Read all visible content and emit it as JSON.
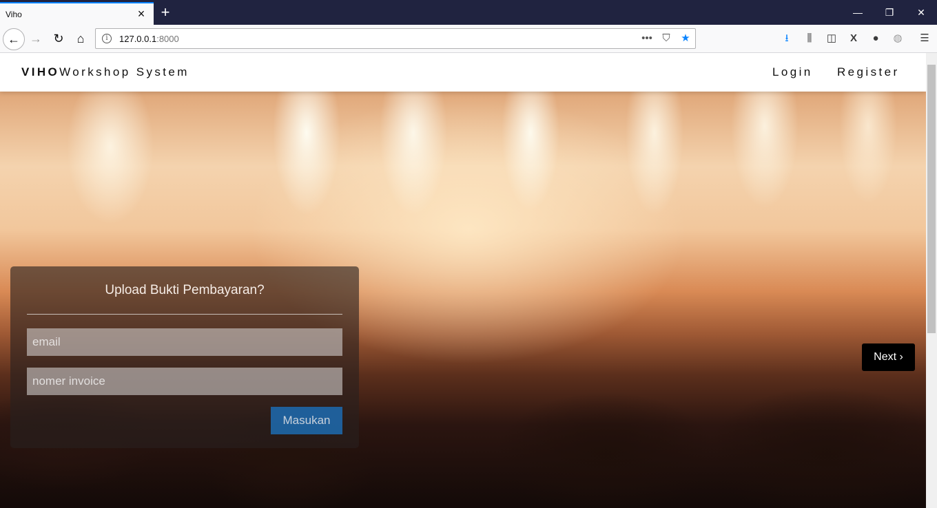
{
  "browser": {
    "tab_title": "Viho",
    "url_host": "127.0.0.1",
    "url_port": ":8000",
    "new_tab_symbol": "+"
  },
  "site": {
    "brand_bold": "VIHO",
    "brand_rest": "Workshop System",
    "nav": {
      "login": "Login",
      "register": "Register"
    }
  },
  "form": {
    "title": "Upload Bukti Pembayaran?",
    "email_placeholder": "email",
    "invoice_placeholder": "nomer invoice",
    "submit_label": "Masukan"
  },
  "carousel": {
    "next_label": "Next ›"
  },
  "colors": {
    "accent": "#0a84ff",
    "button": "#1e67a8",
    "tabbar": "#202340"
  }
}
